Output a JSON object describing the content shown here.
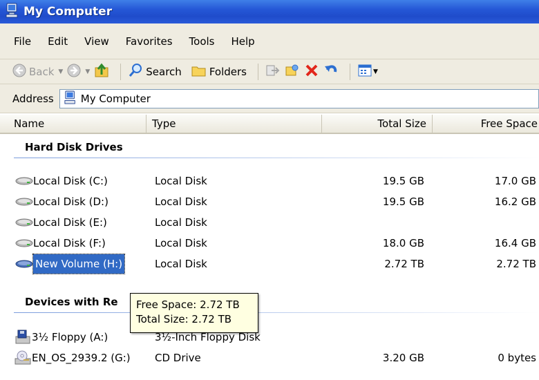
{
  "window": {
    "title": "My Computer"
  },
  "menu": [
    {
      "label": "File"
    },
    {
      "label": "Edit"
    },
    {
      "label": "View"
    },
    {
      "label": "Favorites"
    },
    {
      "label": "Tools"
    },
    {
      "label": "Help"
    }
  ],
  "toolbar": {
    "back_label": "Back",
    "search_label": "Search",
    "folders_label": "Folders"
  },
  "address": {
    "label": "Address",
    "value": "My Computer"
  },
  "columns": {
    "name": "Name",
    "type": "Type",
    "total": "Total Size",
    "free": "Free Space"
  },
  "groups": {
    "hard_disk": {
      "title": "Hard Disk Drives"
    },
    "removable": {
      "title": "Devices with Re"
    }
  },
  "drives": [
    {
      "name": "Local Disk (C:)",
      "type": "Local Disk",
      "total": "19.5 GB",
      "free": "17.0 GB"
    },
    {
      "name": "Local Disk (D:)",
      "type": "Local Disk",
      "total": "19.5 GB",
      "free": "16.2 GB"
    },
    {
      "name": "Local Disk (E:)",
      "type": "Local Disk",
      "total": "",
      "free": ""
    },
    {
      "name": "Local Disk (F:)",
      "type": "Local Disk",
      "total": "18.0 GB",
      "free": "16.4 GB"
    },
    {
      "name": "New Volume (H:)",
      "type": "Local Disk",
      "total": "2.72 TB",
      "free": "2.72 TB"
    }
  ],
  "devices": [
    {
      "name": "3½ Floppy (A:)",
      "type": "3½-Inch Floppy Disk",
      "total": "",
      "free": ""
    },
    {
      "name": "EN_OS_2939.2 (G:)",
      "type": "CD Drive",
      "total": "3.20 GB",
      "free": "0 bytes"
    }
  ],
  "tooltip": {
    "free": "Free Space: 2.72 TB",
    "total": "Total Size: 2.72 TB"
  },
  "colors": {
    "title_bar": "#2557d6",
    "selection": "#316ac5",
    "tooltip_bg": "#ffffe1",
    "chrome": "#efece1"
  }
}
